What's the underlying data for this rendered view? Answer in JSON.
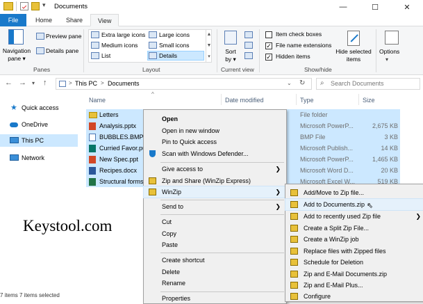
{
  "window": {
    "title": "Documents",
    "minimize": "—",
    "maximize": "☐",
    "close": "✕"
  },
  "tabs": [
    {
      "label": "File"
    },
    {
      "label": "Home"
    },
    {
      "label": "Share"
    },
    {
      "label": "View"
    }
  ],
  "ribbon": {
    "navigation_pane": "Navigation\npane ▾",
    "preview_pane": "Preview pane",
    "details_pane": "Details pane",
    "panes_group": "Panes",
    "layout": [
      "Extra large icons",
      "Large icons",
      "Medium icons",
      "Small icons",
      "List",
      "Details"
    ],
    "layout_group": "Layout",
    "sort_by": "Sort\nby ▾",
    "current_view_group": "Current view",
    "item_check_boxes": "Item check boxes",
    "file_name_extensions": "File name extensions",
    "hidden_items": "Hidden items",
    "hide_selected": "Hide selected\nitems",
    "show_hide_group": "Show/hide",
    "options": "Options"
  },
  "address": {
    "path": [
      "This PC",
      "Documents"
    ],
    "separator": ">",
    "search_placeholder": "Search Documents"
  },
  "nav_pane": [
    {
      "label": "Quick access"
    },
    {
      "label": "OneDrive"
    },
    {
      "label": "This PC"
    },
    {
      "label": "Network"
    }
  ],
  "columns": [
    "Name",
    "Date modified",
    "Type",
    "Size"
  ],
  "files": [
    {
      "name": "Letters",
      "type": "File folder",
      "size": ""
    },
    {
      "name": "Analysis.pptx",
      "type": "Microsoft PowerP...",
      "size": "2,675 KB"
    },
    {
      "name": "BUBBLES.BMP",
      "type": "BMP File",
      "size": "3 KB"
    },
    {
      "name": "Curried Favor.pu",
      "type": "Microsoft Publish...",
      "size": "14 KB"
    },
    {
      "name": "New Spec.ppt",
      "type": "Microsoft PowerP...",
      "size": "1,465 KB"
    },
    {
      "name": "Recipes.docx",
      "type": "Microsoft Word D...",
      "size": "20 KB"
    },
    {
      "name": "Structural forms",
      "type": "Microsoft Excel W...",
      "size": "519 KB"
    }
  ],
  "context_menu": [
    "Open",
    "Open in new window",
    "Pin to Quick access",
    "Scan with Windows Defender...",
    "Give access to",
    "Zip and Share (WinZip Express)",
    "WinZip",
    "Send to",
    "Cut",
    "Copy",
    "Paste",
    "Create shortcut",
    "Delete",
    "Rename",
    "Properties"
  ],
  "winzip_submenu": [
    "Add/Move to Zip file...",
    "Add to Documents.zip",
    "Add to recently used Zip file",
    "Create a Split Zip File...",
    "Create a WinZip job",
    "Replace files with Zipped files",
    "Schedule for Deletion",
    "Zip and E-Mail Documents.zip",
    "Zip and E-Mail Plus...",
    "Configure"
  ],
  "status_text": "7 items   7 items selected",
  "watermark": "Keystool.com",
  "colors": {
    "accent": "#1979ca",
    "selection": "#cce8ff",
    "menu_bg": "#f0f0f0"
  }
}
